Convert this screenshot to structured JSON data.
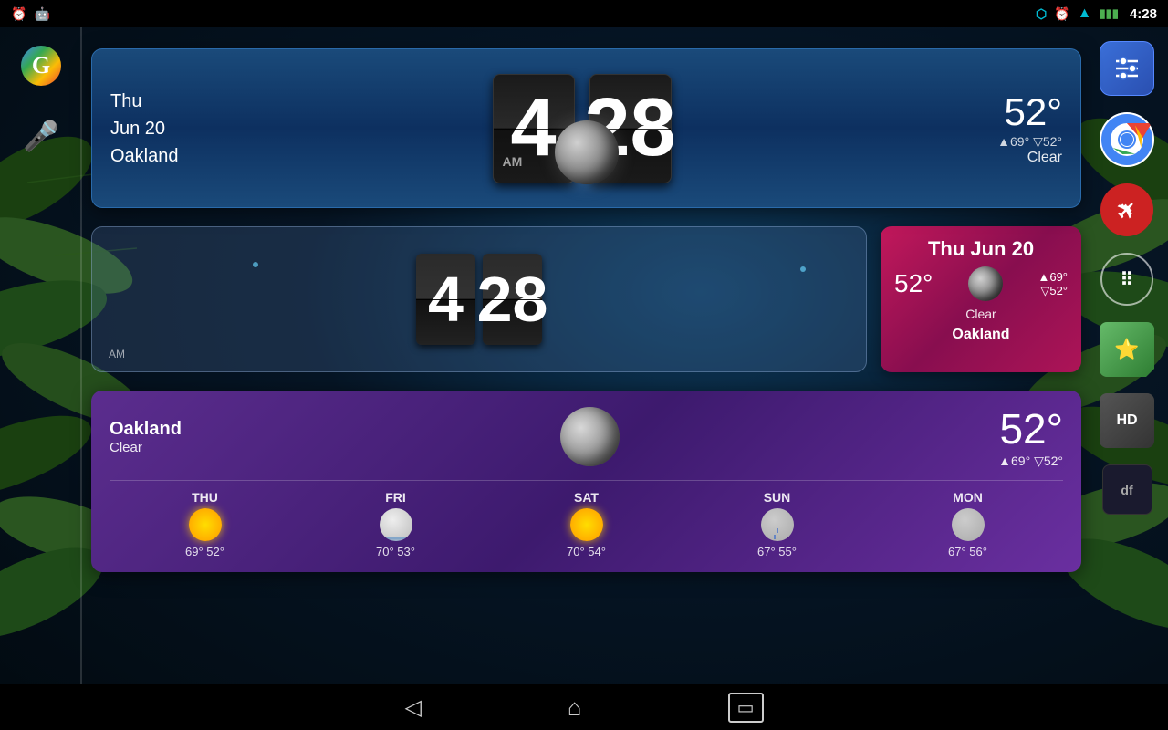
{
  "statusBar": {
    "time": "4:28",
    "bluetooth_icon": "⬡",
    "alarm_icon": "⏰",
    "wifi_icon": "▲",
    "battery_icon": "🔋"
  },
  "leftSidebar": {
    "google_label": "G",
    "mic_label": "🎤"
  },
  "flipClock": {
    "date_line1": "Thu",
    "date_line2": "Jun 20",
    "date_line3": "Oakland",
    "hour": "4",
    "minute": "28",
    "am_pm": "AM",
    "temp_main": "52°",
    "temp_high": "▲69°",
    "temp_low": "▽52°",
    "condition": "Clear"
  },
  "miniClock": {
    "hour": "4",
    "minute": "28",
    "am_pm": "AM"
  },
  "weatherCard": {
    "date": "Thu Jun 20",
    "temp": "52°",
    "temp_high": "▲69°",
    "temp_low": "▽52°",
    "condition": "Clear",
    "city": "Oakland"
  },
  "bottomWeather": {
    "city": "Oakland",
    "condition": "Clear",
    "temp_main": "52°",
    "temp_high": "▲69°",
    "temp_low": "▽52°",
    "forecast": [
      {
        "day": "THU",
        "high": "69°",
        "low": "52°",
        "icon": "sun"
      },
      {
        "day": "FRI",
        "high": "70°",
        "low": "53°",
        "icon": "cloudy"
      },
      {
        "day": "SAT",
        "high": "70°",
        "low": "54°",
        "icon": "sun"
      },
      {
        "day": "SUN",
        "high": "67°",
        "low": "55°",
        "icon": "rain"
      },
      {
        "day": "MON",
        "high": "67°",
        "low": "56°",
        "icon": "rain"
      }
    ]
  },
  "navBar": {
    "back": "◁",
    "home": "⌂",
    "recents": "▭"
  },
  "rightSidebar": {
    "apps": [
      "settings-sliders",
      "chrome",
      "plane",
      "grid",
      "star-chart",
      "hd",
      "df"
    ]
  }
}
